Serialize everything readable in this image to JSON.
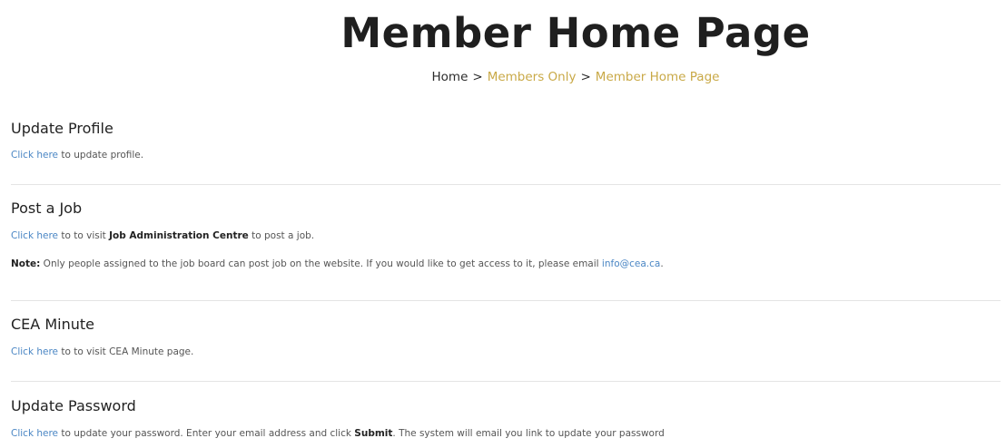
{
  "page": {
    "title": "Member Home Page"
  },
  "breadcrumb": {
    "home": "Home",
    "separator": ">",
    "members_only": "Members Only",
    "current": "Member Home Page"
  },
  "sections": {
    "update_profile": {
      "heading": "Update Profile",
      "link": "Click here",
      "text": " to update profile."
    },
    "post_job": {
      "heading": "Post a Job",
      "link": "Click here",
      "text_before": " to to visit ",
      "strong": "Job Administration Centre",
      "text_after": " to post a job.",
      "note_label": "Note:",
      "note_text": " Only people assigned to the job board can post job on the website. If you would like to get access to it, please email ",
      "note_email": "info@cea.ca",
      "note_end": "."
    },
    "cea_minute": {
      "heading": "CEA Minute",
      "link": "Click here",
      "text": " to to visit CEA Minute page."
    },
    "update_password": {
      "heading": "Update Password",
      "link": "Click here",
      "text_before": " to update your password. Enter your email address and click ",
      "strong": "Submit",
      "text_after": ". The system will email you link to update your password"
    }
  },
  "colors": {
    "link": "#4a86c4",
    "breadcrumb_accent": "#c9a947",
    "divider": "#e4e4e4"
  }
}
